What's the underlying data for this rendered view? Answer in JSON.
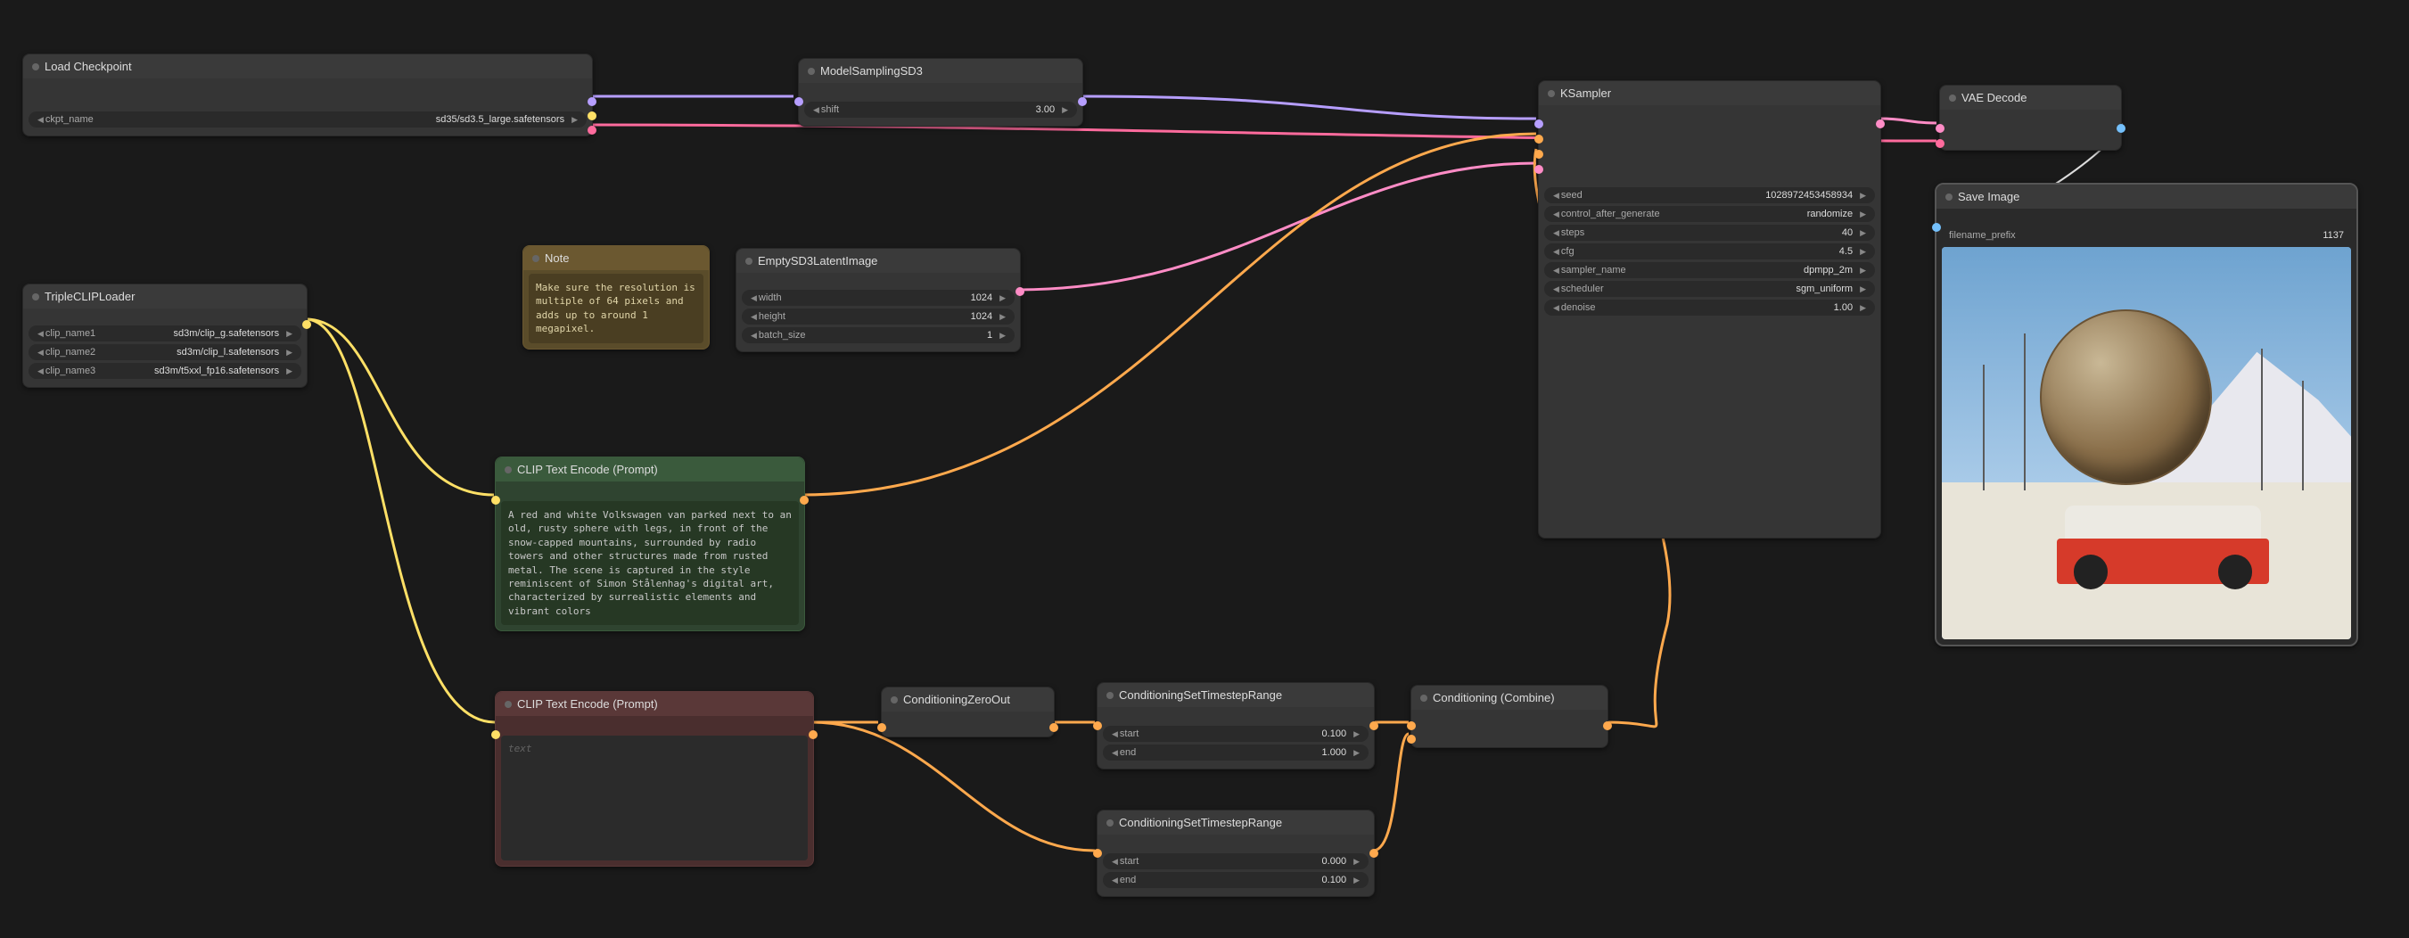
{
  "nodes": {
    "loadCheckpoint": {
      "title": "Load Checkpoint",
      "ckpt_name_label": "ckpt_name",
      "ckpt_name_value": "sd35/sd3.5_large.safetensors"
    },
    "modelSampling": {
      "title": "ModelSamplingSD3",
      "shift_label": "shift",
      "shift_value": "3.00"
    },
    "tripleCLIP": {
      "title": "TripleCLIPLoader",
      "clip1_label": "clip_name1",
      "clip1_value": "sd3m/clip_g.safetensors",
      "clip2_label": "clip_name2",
      "clip2_value": "sd3m/clip_l.safetensors",
      "clip3_label": "clip_name3",
      "clip3_value": "sd3m/t5xxl_fp16.safetensors"
    },
    "note": {
      "title": "Note",
      "text": "Make sure the resolution is multiple of 64 pixels and adds up to around 1 megapixel."
    },
    "emptyLatent": {
      "title": "EmptySD3LatentImage",
      "width_label": "width",
      "width_value": "1024",
      "height_label": "height",
      "height_value": "1024",
      "batch_label": "batch_size",
      "batch_value": "1"
    },
    "clipPos": {
      "title": "CLIP Text Encode (Prompt)",
      "text": "A red and white Volkswagen van parked next to an old, rusty sphere with legs, in front of the snow-capped mountains, surrounded by radio towers and other structures made from rusted metal. The scene is captured in the style reminiscent of Simon Stålenhag's digital art, characterized by surrealistic elements and vibrant colors"
    },
    "clipNeg": {
      "title": "CLIP Text Encode (Prompt)",
      "placeholder": "text"
    },
    "condZero": {
      "title": "ConditioningZeroOut"
    },
    "condRange1": {
      "title": "ConditioningSetTimestepRange",
      "start_label": "start",
      "start_value": "0.100",
      "end_label": "end",
      "end_value": "1.000"
    },
    "condRange2": {
      "title": "ConditioningSetTimestepRange",
      "start_label": "start",
      "start_value": "0.000",
      "end_label": "end",
      "end_value": "0.100"
    },
    "condCombine": {
      "title": "Conditioning (Combine)"
    },
    "ksampler": {
      "title": "KSampler",
      "seed_label": "seed",
      "seed_value": "1028972453458934",
      "control_label": "control_after_generate",
      "control_value": "randomize",
      "steps_label": "steps",
      "steps_value": "40",
      "cfg_label": "cfg",
      "cfg_value": "4.5",
      "sampler_label": "sampler_name",
      "sampler_value": "dpmpp_2m",
      "scheduler_label": "scheduler",
      "scheduler_value": "sgm_uniform",
      "denoise_label": "denoise",
      "denoise_value": "1.00"
    },
    "vaeDecode": {
      "title": "VAE Decode"
    },
    "saveImage": {
      "title": "Save Image",
      "prefix_label": "filename_prefix",
      "prefix_value": "1137"
    }
  }
}
